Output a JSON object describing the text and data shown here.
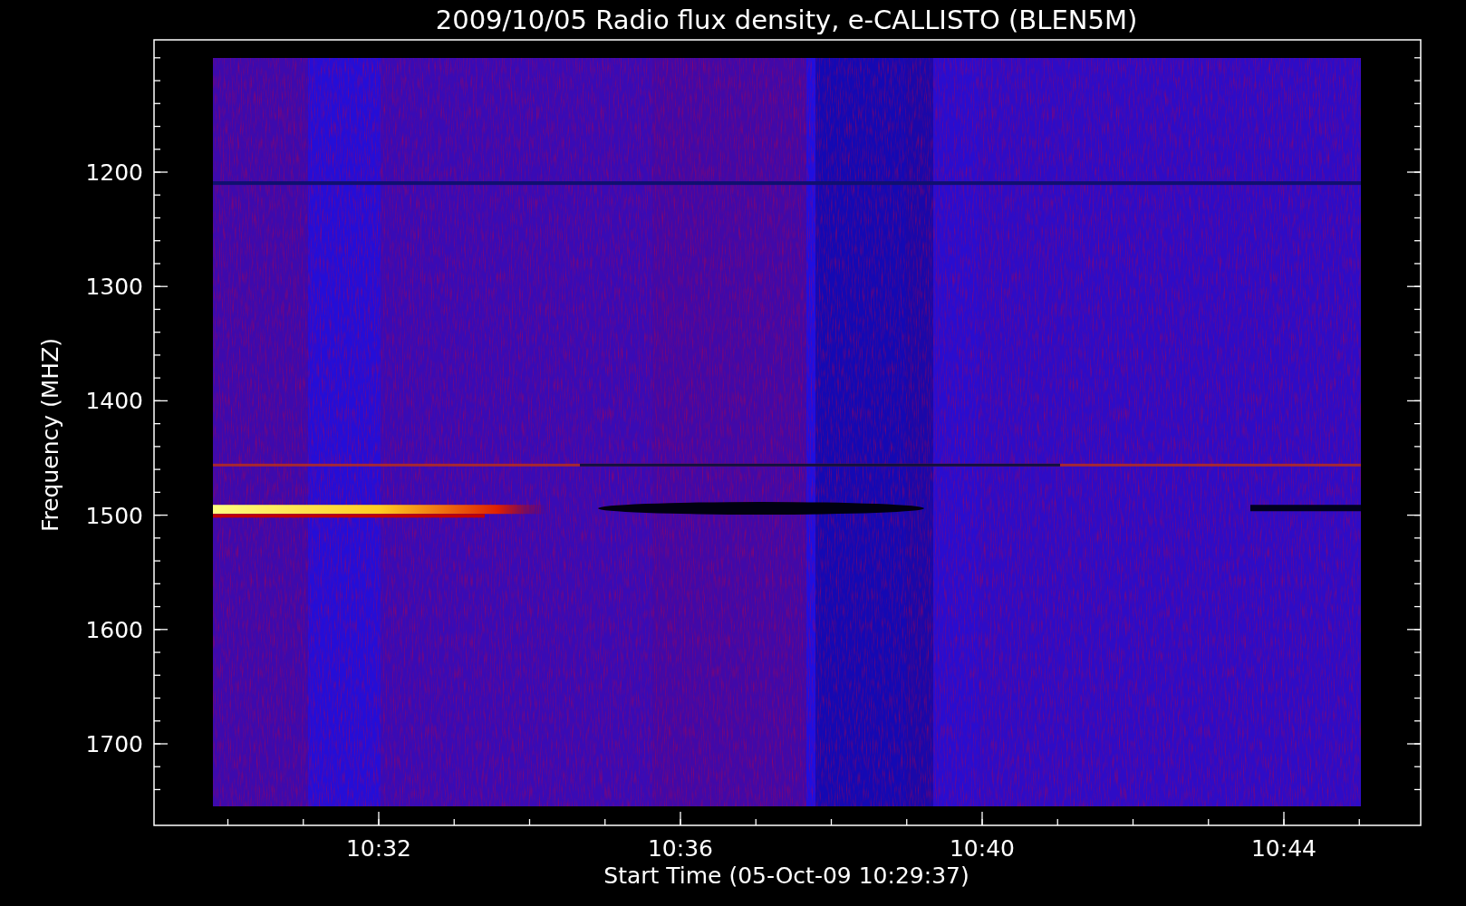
{
  "plot": {
    "title": "2009/10/05  Radio flux density, e-CALLISTO (BLEN5M)",
    "y_axis": {
      "label": "Frequency (MHZ)",
      "ticks": [
        "1200",
        "1300",
        "1400",
        "1500",
        "1600",
        "1700"
      ]
    },
    "x_axis": {
      "label": "Start Time (05-Oct-09 10:29:37)",
      "ticks": [
        "10:32",
        "10:36",
        "10:40",
        "10:44"
      ]
    }
  }
}
